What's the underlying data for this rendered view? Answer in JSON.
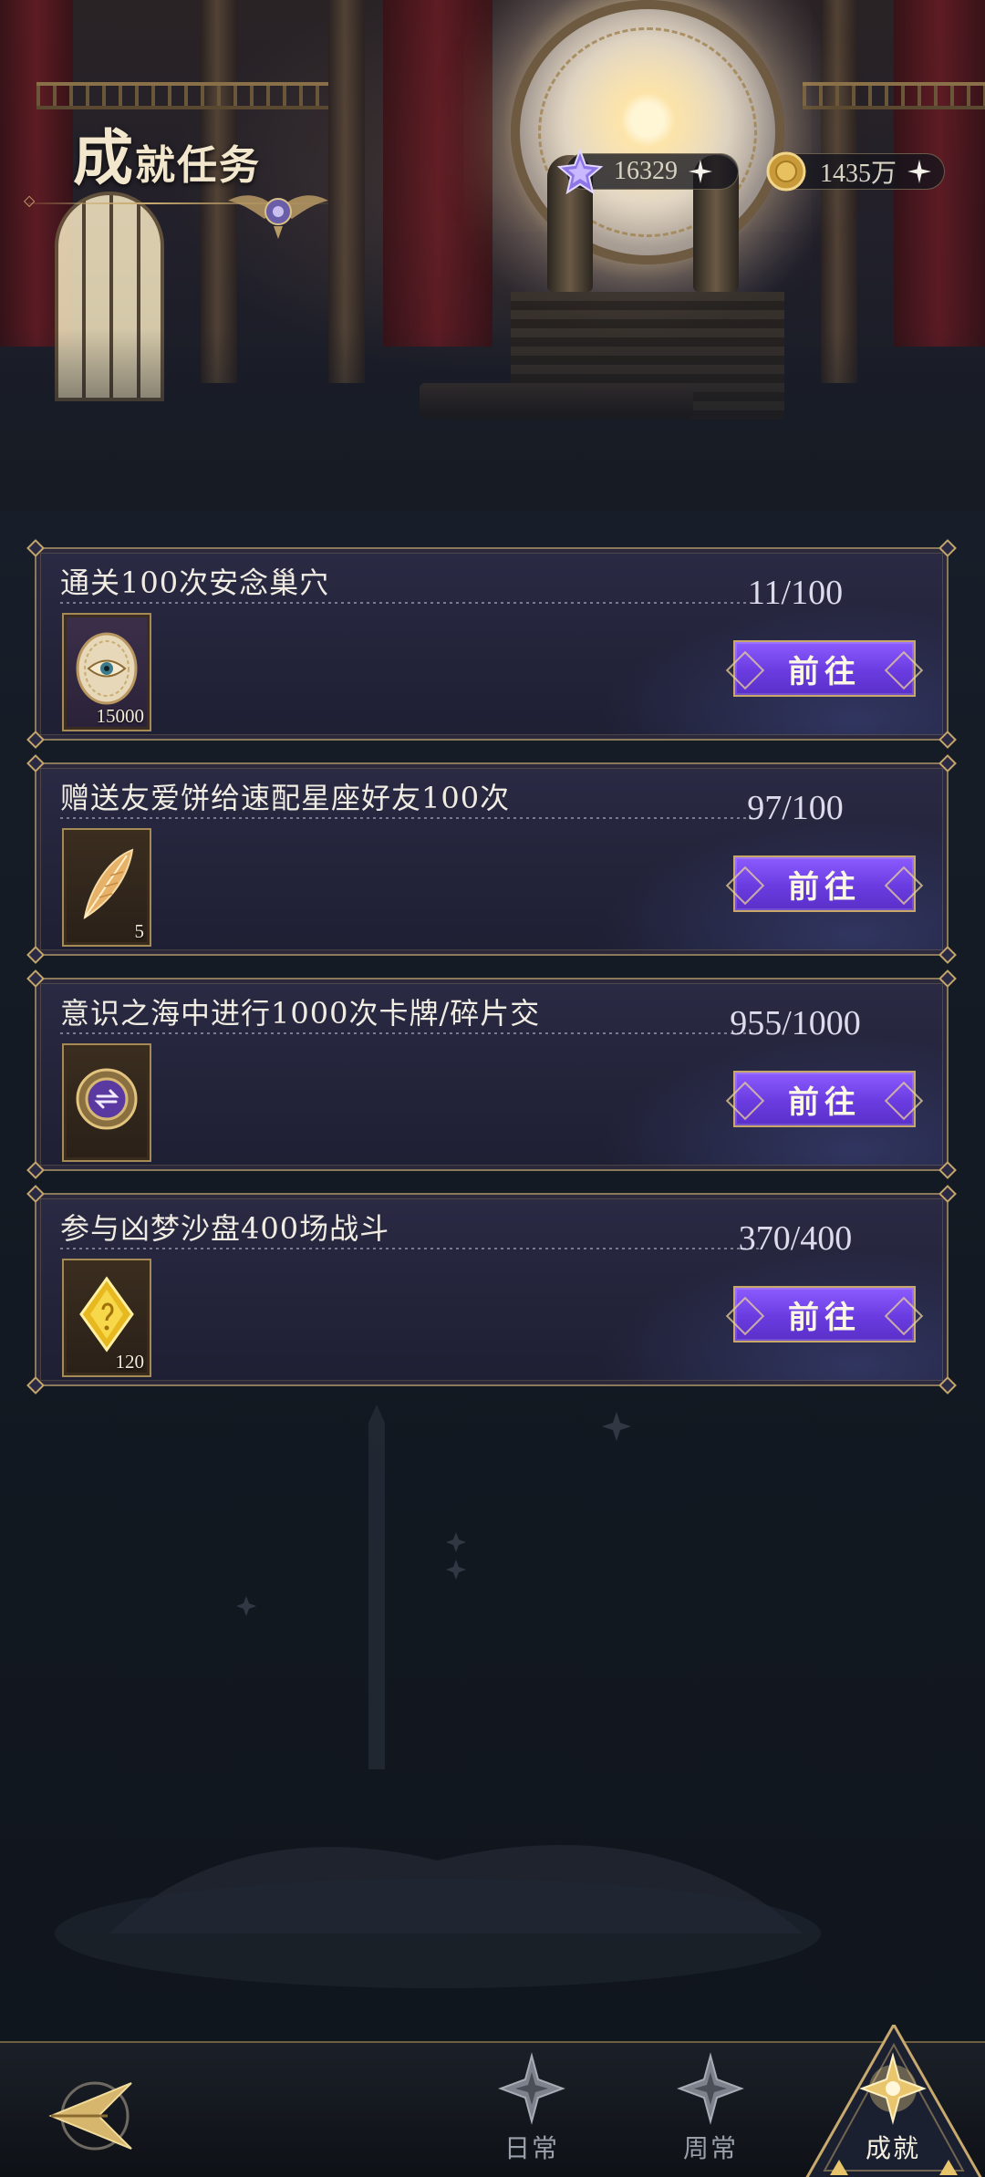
{
  "header": {
    "title_first": "成",
    "title_rest": "就任务"
  },
  "currencies": [
    {
      "icon": "purple-star-crystal-icon",
      "value": "16329"
    },
    {
      "icon": "gold-coin-icon",
      "value": "1435万"
    }
  ],
  "tasks": [
    {
      "name": "通关100次安念巢穴",
      "progress": "11/100",
      "reward_icon": "eye-coin-icon",
      "reward_qty": "15000",
      "button": "前往"
    },
    {
      "name": "赠送友爱饼给速配星座好友100次",
      "progress": "97/100",
      "reward_icon": "golden-feather-icon",
      "reward_qty": "5",
      "button": "前往"
    },
    {
      "name": "意识之海中进行1000次卡牌/碎片交",
      "progress": "955/1000",
      "reward_icon": "exchange-medallion-icon",
      "reward_qty": "",
      "button": "前往"
    },
    {
      "name": "参与凶梦沙盘400场战斗",
      "progress": "370/400",
      "reward_icon": "gold-crystal-icon",
      "reward_qty": "120",
      "button": "前往"
    }
  ],
  "nav": {
    "tabs": [
      {
        "label": "日常",
        "icon": "daily-star-icon",
        "active": false
      },
      {
        "label": "周常",
        "icon": "weekly-star-icon",
        "active": false
      },
      {
        "label": "成就",
        "icon": "achievement-star-icon",
        "active": true
      }
    ]
  },
  "colors": {
    "accent_purple": "#7a4cf0",
    "gold_border": "#c8a86a",
    "card_bg": "#25253d",
    "background": "#141a22"
  }
}
